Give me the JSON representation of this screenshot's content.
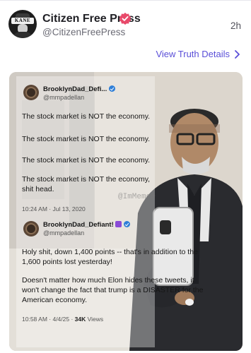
{
  "post": {
    "account_name": "Citizen Free Press",
    "account_handle": "@CitizenFreePress",
    "time": "2h",
    "details_link": "View Truth Details",
    "avatar_text": "KANE"
  },
  "image": {
    "watermark": "@ImMeme0",
    "tweet1": {
      "name": "BrooklynDad_Defi...",
      "handle": "@mmpadellan",
      "lines": [
        "The stock market is NOT the economy.",
        "The stock market is NOT the economy.",
        "The stock market is NOT the economy.",
        "The stock market is NOT the economy, shit head."
      ],
      "meta": "10:24 AM · Jul 13, 2020"
    },
    "tweet2": {
      "name": "BrooklynDad_Defiant!",
      "handle": "@mmpadellan",
      "para1": "Holy shit, down 1,400 points -- that's in addition to the 1,600 points lost yesterday!",
      "para2": "Doesn't matter how much Elon hides these tweets, it won't change the fact that trump is a DISASTER for the American economy.",
      "meta_time": "10:58 AM · 4/4/25 · ",
      "meta_views_count": "34K",
      "meta_views_label": " Views"
    }
  },
  "colors": {
    "accent": "#5a4fd8",
    "verified": "#e8496a",
    "tweet_verified": "#2f7fd8"
  }
}
